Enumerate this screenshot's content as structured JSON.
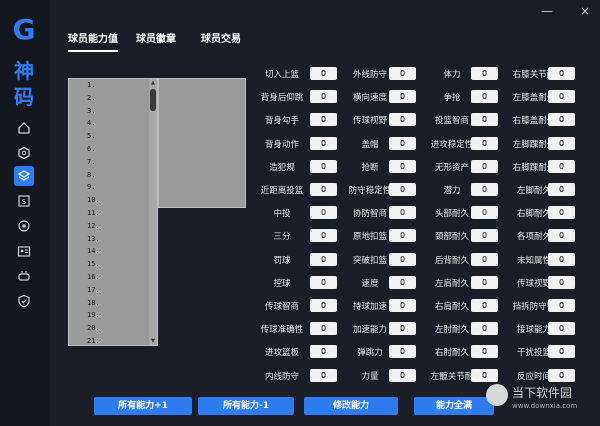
{
  "brand": {
    "logo_letter": "G",
    "logo_text": "神码"
  },
  "nav": [
    {
      "icon": "home-icon"
    },
    {
      "icon": "hexagon-icon"
    },
    {
      "icon": "layers-icon",
      "active": true
    },
    {
      "icon": "s-square-icon"
    },
    {
      "icon": "circle-gear-icon"
    },
    {
      "icon": "id-card-icon"
    },
    {
      "icon": "gamepad-icon"
    },
    {
      "icon": "shield-check-icon"
    }
  ],
  "window": {
    "minimize": "—",
    "close": "×"
  },
  "tabs": [
    {
      "label": "球员能力值",
      "active": true
    },
    {
      "label": "球员徽章"
    },
    {
      "label": "球员交易"
    }
  ],
  "list_items": [
    "1.",
    "2.",
    "3.",
    "4.",
    "5.",
    "6.",
    "7.",
    "8.",
    "9.",
    "10.",
    "11.",
    "12.",
    "13.",
    "14.",
    "15.",
    "16.",
    "17.",
    "18.",
    "19.",
    "20.",
    "21."
  ],
  "stats": [
    [
      {
        "label": "切入上篮",
        "value": "0"
      },
      {
        "label": "外线防守",
        "value": "0"
      },
      {
        "label": "体力",
        "value": "0"
      },
      {
        "label": "右膝关节耐",
        "value": "0"
      }
    ],
    [
      {
        "label": "背身后仰跳",
        "value": "0"
      },
      {
        "label": "横向速度",
        "value": "0"
      },
      {
        "label": "争抢",
        "value": "0"
      },
      {
        "label": "左膝盖耐久",
        "value": "0"
      }
    ],
    [
      {
        "label": "背身勾手",
        "value": "0"
      },
      {
        "label": "传球视野",
        "value": "0"
      },
      {
        "label": "投篮智商",
        "value": "0"
      },
      {
        "label": "右膝盖耐久",
        "value": "0"
      }
    ],
    [
      {
        "label": "背身动作",
        "value": "0"
      },
      {
        "label": "盖帽",
        "value": "0"
      },
      {
        "label": "进攻稳定性",
        "value": "0"
      },
      {
        "label": "左脚踝耐久",
        "value": "0"
      }
    ],
    [
      {
        "label": "造犯规",
        "value": "0"
      },
      {
        "label": "抢断",
        "value": "0"
      },
      {
        "label": "无形资产",
        "value": "0"
      },
      {
        "label": "右脚踝耐久",
        "value": "0"
      }
    ],
    [
      {
        "label": "近距离投篮",
        "value": "0"
      },
      {
        "label": "防守稳定性",
        "value": "0"
      },
      {
        "label": "潜力",
        "value": "0"
      },
      {
        "label": "左脚耐久",
        "value": "0"
      }
    ],
    [
      {
        "label": "中投",
        "value": "0"
      },
      {
        "label": "协防智商",
        "value": "0"
      },
      {
        "label": "头部耐久",
        "value": "0"
      },
      {
        "label": "右脚耐久",
        "value": "0"
      }
    ],
    [
      {
        "label": "三分",
        "value": "0"
      },
      {
        "label": "原地扣篮",
        "value": "0"
      },
      {
        "label": "颈部耐久",
        "value": "0"
      },
      {
        "label": "各项耐久",
        "value": "0"
      }
    ],
    [
      {
        "label": "罚球",
        "value": "0"
      },
      {
        "label": "突破扣篮",
        "value": "0"
      },
      {
        "label": "后背耐久",
        "value": "0"
      },
      {
        "label": "未知属性",
        "value": "0"
      }
    ],
    [
      {
        "label": "控球",
        "value": "0"
      },
      {
        "label": "速度",
        "value": "0"
      },
      {
        "label": "左肩耐久",
        "value": "0"
      },
      {
        "label": "传球视野",
        "value": "0"
      }
    ],
    [
      {
        "label": "传球智商",
        "value": "0"
      },
      {
        "label": "持球加速",
        "value": "0"
      },
      {
        "label": "右肩耐久",
        "value": "0"
      },
      {
        "label": "挡拆防守智",
        "value": "0"
      }
    ],
    [
      {
        "label": "传球准确性",
        "value": "0"
      },
      {
        "label": "加速能力",
        "value": "0"
      },
      {
        "label": "左肘耐久",
        "value": "0"
      },
      {
        "label": "接球能力",
        "value": "0"
      }
    ],
    [
      {
        "label": "进攻篮板",
        "value": "0"
      },
      {
        "label": "弹跳力",
        "value": "0"
      },
      {
        "label": "右肘耐久",
        "value": "0"
      },
      {
        "label": "干扰投篮",
        "value": "0"
      }
    ],
    [
      {
        "label": "内线防守",
        "value": "0"
      },
      {
        "label": "力量",
        "value": "0"
      },
      {
        "label": "左髋关节耐",
        "value": "0"
      },
      {
        "label": "反应时间",
        "value": "0"
      }
    ]
  ],
  "buttons": [
    {
      "label": "所有能力+1",
      "name": "all-abilities-plus-button"
    },
    {
      "label": "所有能力-1",
      "name": "all-abilities-minus-button"
    },
    {
      "label": "修改能力",
      "name": "modify-ability-button"
    },
    {
      "label": "能力全满",
      "name": "max-all-abilities-button"
    }
  ],
  "watermark": {
    "title": "当下软件园",
    "url": "www.downxia.com"
  }
}
